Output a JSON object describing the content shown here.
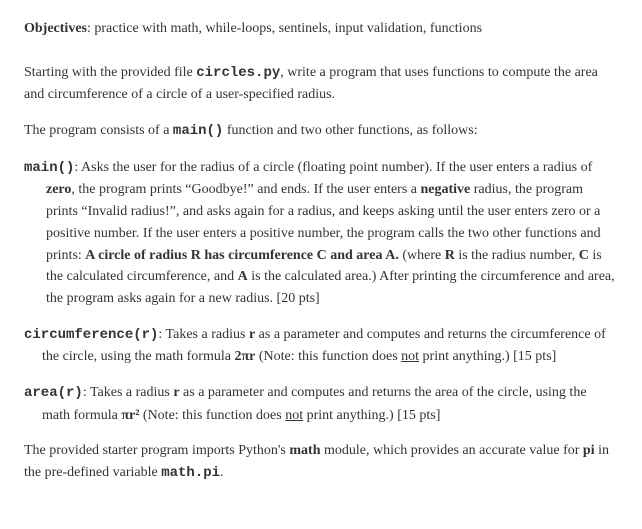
{
  "objectives": {
    "label": "Objectives",
    "text": ": practice with math, while-loops, sentinels, input validation, functions"
  },
  "intro": {
    "p1a": "Starting with the provided file ",
    "p1_code": "circles.py",
    "p1b": ", write a program that uses functions to compute the area and circumference of a circle of a user-specified radius.",
    "p2a": "The program consists of a ",
    "p2_code": "main()",
    "p2b": " function and two other functions, as follows:"
  },
  "main_fn": {
    "sig": "main()",
    "t1": ": Asks the user for the radius of a circle (floating point number).  If the user enters a radius of ",
    "b1": "zero",
    "t2": ", the program prints “Goodbye!” and ends.  If the user enters a ",
    "b2": "negative",
    "t3": " radius, the program prints “Invalid radius!”, and asks again for a radius, and keeps asking until the user enters zero or a positive number.  If the user enters a positive number, the program calls the two other functions and prints:  ",
    "b3": "A circle of radius R has circumference C and area A.",
    "t4": " (where ",
    "b4": "R",
    "t5": " is the radius number, ",
    "b5": "C",
    "t6": " is the calculated circumference, and ",
    "b6": "A",
    "t7": " is the calculated area.) After printing the circumference and area, the program asks again for a new radius. [20 pts]"
  },
  "circ_fn": {
    "sig": "circumference(r)",
    "t1": ":  Takes a radius ",
    "b1": "r",
    "t2": " as a parameter and computes and returns the circumference of the circle, using the math formula  ",
    "formula": "2πr",
    "t3": "   (Note: this function does ",
    "u1": "not",
    "t4": " print anything.) [15 pts]"
  },
  "area_fn": {
    "sig": "area(r)",
    "t1": ": Takes a radius ",
    "b1": "r",
    "t2": " as a parameter and computes and returns the area of the circle, using the math formula  ",
    "formula": "πr²",
    "t3": "   (Note: this function does ",
    "u1": "not",
    "t4": " print anything.) [15 pts]"
  },
  "footer": {
    "t1": "The provided starter program imports Python's ",
    "b1": "math",
    "t2": " module, which provides an accurate value for ",
    "b2": "pi",
    "t3": " in the pre-defined variable ",
    "c1": "math.pi",
    "t4": "."
  }
}
